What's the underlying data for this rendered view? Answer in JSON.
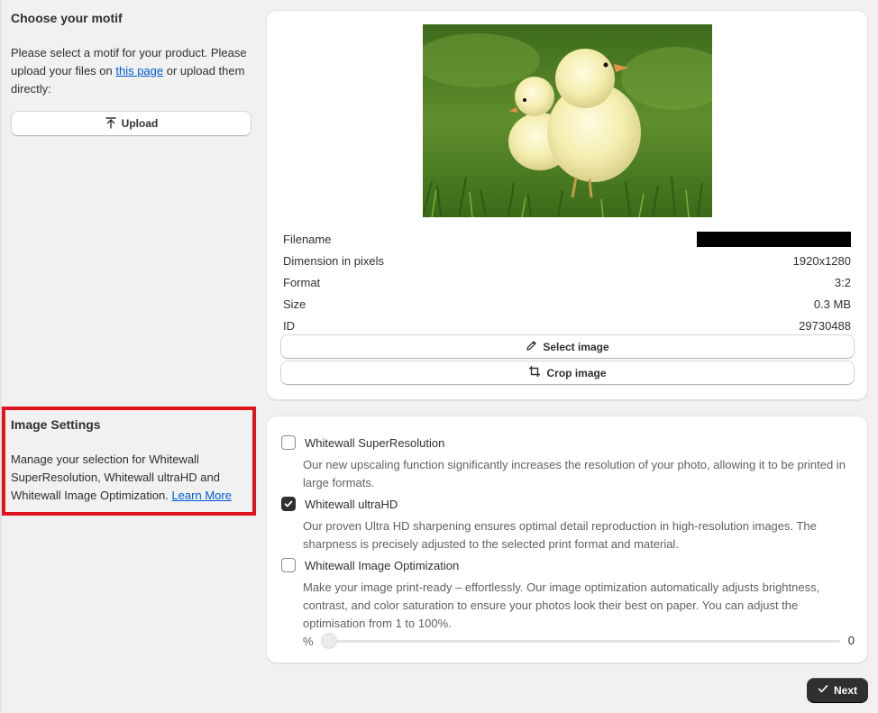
{
  "motif": {
    "title": "Choose your motif",
    "desc_before_link": "Please select a motif for your product. Please upload your files on ",
    "link_text": "this page",
    "desc_after_link": " or upload them directly:",
    "upload_label": "Upload"
  },
  "image_info": {
    "rows": [
      {
        "label": "Filename",
        "value": ""
      },
      {
        "label": "Dimension in pixels",
        "value": "1920x1280"
      },
      {
        "label": "Format",
        "value": "3:2"
      },
      {
        "label": "Size",
        "value": "0.3 MB"
      },
      {
        "label": "ID",
        "value": "29730488"
      }
    ],
    "select_label": "Select image",
    "crop_label": "Crop image"
  },
  "image_settings": {
    "title": "Image Settings",
    "desc": "Manage your selection for Whitewall SuperResolution, Whitewall ultraHD and Whitewall Image Optimization. ",
    "learn_more": "Learn More",
    "options": [
      {
        "label": "Whitewall SuperResolution",
        "checked": false,
        "desc": "Our new upscaling function significantly increases the resolution of your photo, allowing it to be printed in large formats."
      },
      {
        "label": "Whitewall ultraHD",
        "checked": true,
        "desc": "Our proven Ultra HD sharpening ensures optimal detail reproduction in high-resolution images. The sharpness is precisely adjusted to the selected print format and material."
      },
      {
        "label": "Whitewall Image Optimization",
        "checked": false,
        "desc": "Make your image print-ready – effortlessly. Our image optimization automatically adjusts brightness, contrast, and color saturation to ensure your photos look their best on paper. You can adjust the optimisation from 1 to 100%."
      }
    ],
    "slider": {
      "unit": "%",
      "value": "0"
    }
  },
  "next_label": "Next"
}
